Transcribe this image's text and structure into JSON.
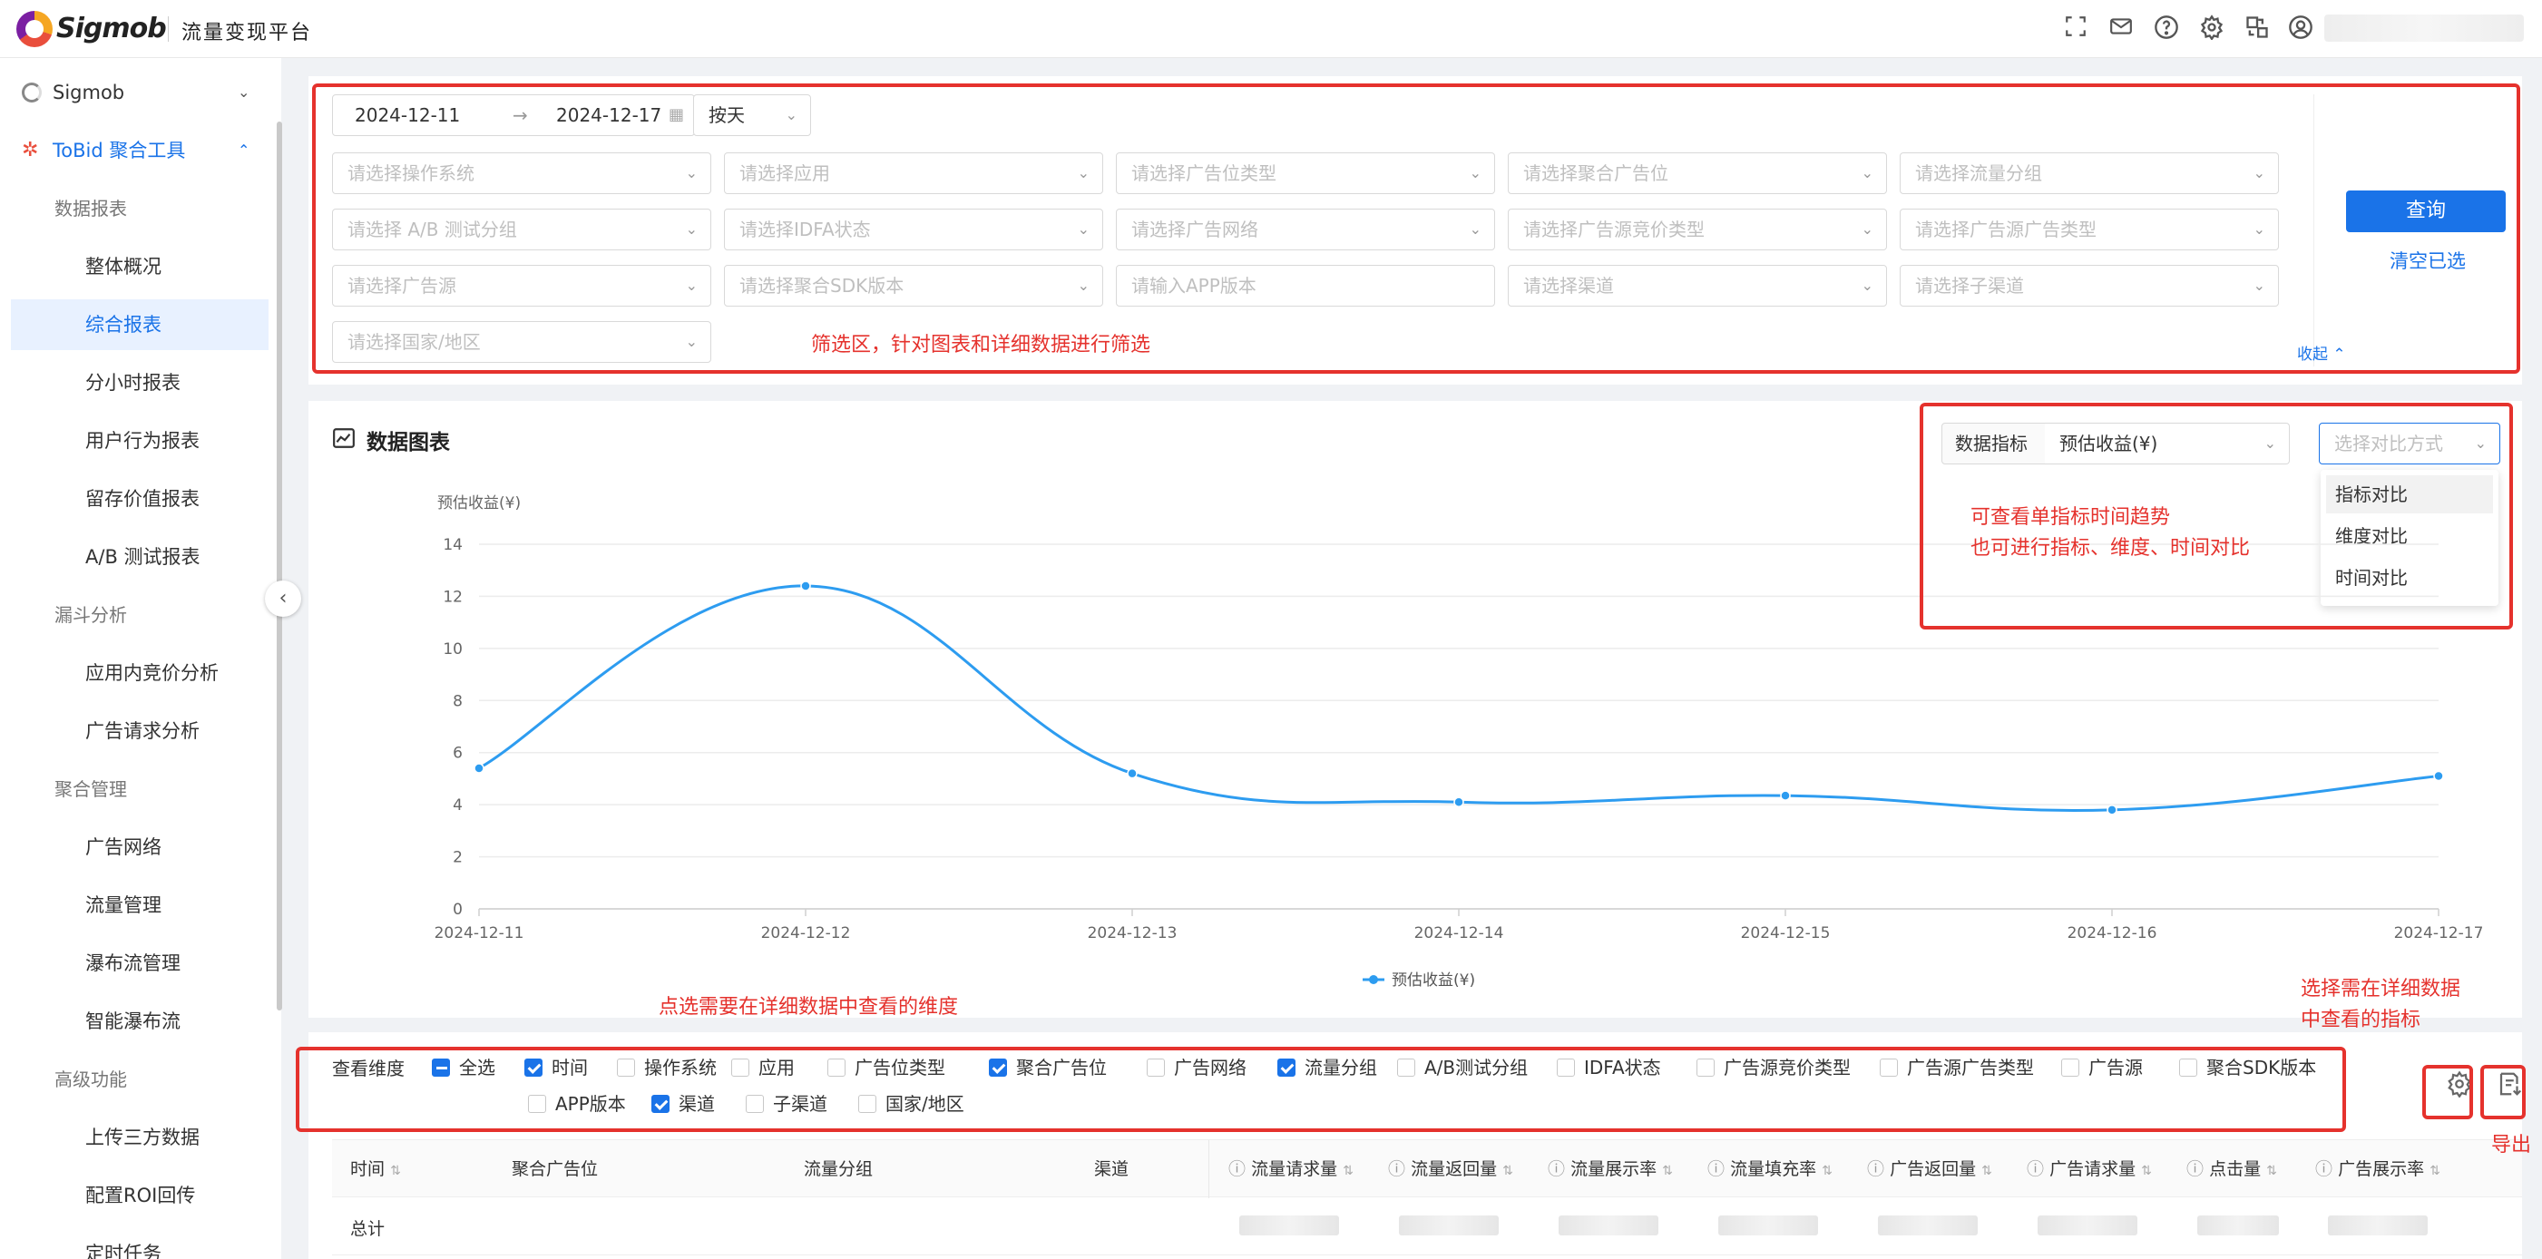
{
  "header": {
    "logo_text": "Sigmob",
    "platform_title": "流量变现平台",
    "icons": [
      "fullscreen-icon",
      "mail-icon",
      "help-icon",
      "settings-icon",
      "translate-icon",
      "user-icon"
    ]
  },
  "sidebar": {
    "top_items": [
      {
        "label": "Sigmob",
        "expanded": false
      },
      {
        "label": "ToBid 聚合工具",
        "expanded": true
      }
    ],
    "groups": [
      {
        "title": "数据报表",
        "items": [
          "整体概况",
          "综合报表",
          "分小时报表",
          "用户行为报表",
          "留存价值报表",
          "A/B 测试报表"
        ]
      },
      {
        "title": "漏斗分析",
        "items": [
          "应用内竞价分析",
          "广告请求分析"
        ]
      },
      {
        "title": "聚合管理",
        "items": [
          "广告网络",
          "流量管理",
          "瀑布流管理",
          "智能瀑布流"
        ]
      },
      {
        "title": "高级功能",
        "items": [
          "上传三方数据",
          "配置ROI回传",
          "定时任务"
        ]
      }
    ],
    "active_item": "综合报表"
  },
  "filters": {
    "date_start": "2024-12-11",
    "date_end": "2024-12-17",
    "granularity": "按天",
    "selects": [
      "请选择操作系统",
      "请选择应用",
      "请选择广告位类型",
      "请选择聚合广告位",
      "请选择流量分组",
      "请选择 A/B 测试分组",
      "请选择IDFA状态",
      "请选择广告网络",
      "请选择广告源竞价类型",
      "请选择广告源广告类型",
      "请选择广告源",
      "请选择聚合SDK版本",
      "请输入APP版本",
      "请选择渠道",
      "请选择子渠道",
      "请选择国家/地区"
    ],
    "query_button": "查询",
    "clear_link": "清空已选",
    "collapse_link": "收起",
    "annotation": "筛选区，针对图表和详细数据进行筛选"
  },
  "chart_panel": {
    "title": "数据图表",
    "metric_label": "数据指标",
    "metric_value": "预估收益(¥)",
    "compare_placeholder": "选择对比方式",
    "compare_options": [
      "指标对比",
      "维度对比",
      "时间对比"
    ],
    "annotation_line1": "可查看单指标时间趋势",
    "annotation_line2": "也可进行指标、维度、时间对比"
  },
  "chart_data": {
    "type": "line",
    "title": "",
    "ylabel": "预估收益(¥)",
    "xlabel": "",
    "x": [
      "2024-12-11",
      "2024-12-12",
      "2024-12-13",
      "2024-12-14",
      "2024-12-15",
      "2024-12-16",
      "2024-12-17"
    ],
    "series": [
      {
        "name": "预估收益(¥)",
        "values": [
          5.4,
          12.4,
          5.2,
          4.1,
          4.35,
          3.8,
          5.1
        ],
        "color": "#2d9cf0"
      }
    ],
    "ylim": [
      0,
      14
    ],
    "yticks": [
      "0",
      "2",
      "4",
      "6",
      "8",
      "10",
      "12",
      "14"
    ],
    "grid": true,
    "legend": "bottom-center"
  },
  "dimensions": {
    "label": "查看维度",
    "annotation": "点选需要在详细数据中查看的维度",
    "items": [
      {
        "label": "全选",
        "state": "partial"
      },
      {
        "label": "时间",
        "state": "checked"
      },
      {
        "label": "操作系统",
        "state": "unchecked"
      },
      {
        "label": "应用",
        "state": "unchecked"
      },
      {
        "label": "广告位类型",
        "state": "unchecked"
      },
      {
        "label": "聚合广告位",
        "state": "checked"
      },
      {
        "label": "广告网络",
        "state": "unchecked"
      },
      {
        "label": "流量分组",
        "state": "checked"
      },
      {
        "label": "A/B测试分组",
        "state": "unchecked"
      },
      {
        "label": "IDFA状态",
        "state": "unchecked"
      },
      {
        "label": "广告源竞价类型",
        "state": "unchecked"
      },
      {
        "label": "广告源广告类型",
        "state": "unchecked"
      },
      {
        "label": "广告源",
        "state": "unchecked"
      },
      {
        "label": "聚合SDK版本",
        "state": "unchecked"
      },
      {
        "label": "APP版本",
        "state": "unchecked"
      },
      {
        "label": "渠道",
        "state": "checked"
      },
      {
        "label": "子渠道",
        "state": "unchecked"
      },
      {
        "label": "国家/地区",
        "state": "unchecked"
      }
    ]
  },
  "metrics_annotation_line1": "选择需在详细数据",
  "metrics_annotation_line2": "中查看的指标",
  "export_label": "导出",
  "table": {
    "columns": [
      "时间",
      "聚合广告位",
      "流量分组",
      "渠道",
      "流量请求量",
      "流量返回量",
      "流量展示率",
      "流量填充率",
      "广告返回量",
      "广告请求量",
      "点击量",
      "广告展示率"
    ],
    "total_label": "总计"
  }
}
